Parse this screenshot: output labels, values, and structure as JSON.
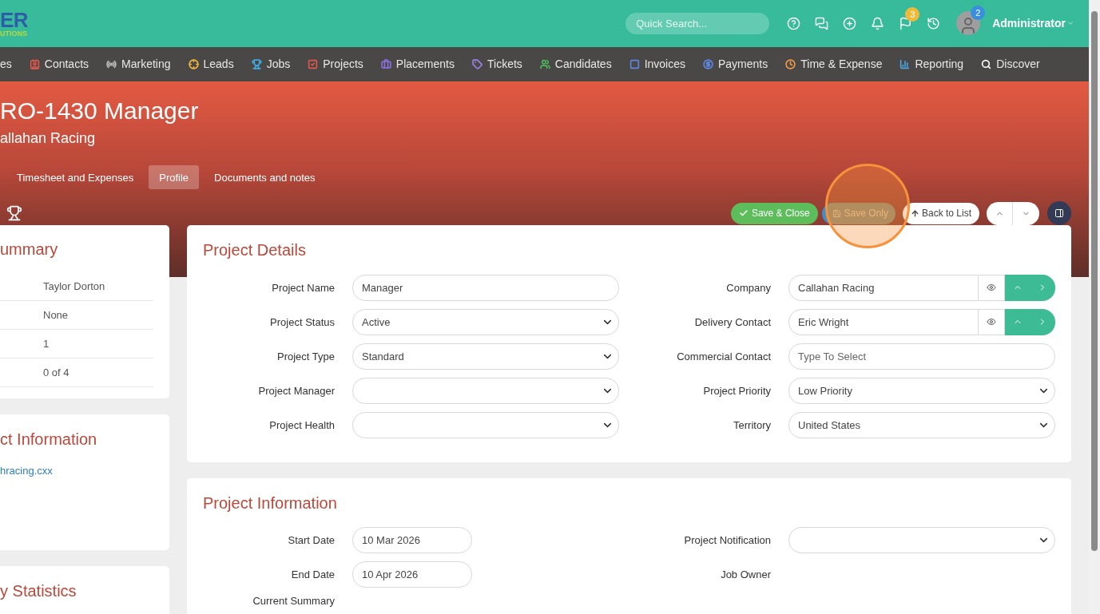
{
  "header": {
    "logo_main": "ER",
    "logo_sub": "UTIONS",
    "search": {
      "placeholder": "Quick Search..."
    },
    "flag_badge": "3",
    "avatar_badge": "2",
    "user": "Administrator"
  },
  "nav": [
    {
      "label": "es"
    },
    {
      "label": "Contacts",
      "color": "#e2574c"
    },
    {
      "label": "Marketing",
      "color": "#bdbdbd"
    },
    {
      "label": "Leads",
      "color": "#f2b63c"
    },
    {
      "label": "Jobs",
      "color": "#3fa9de"
    },
    {
      "label": "Projects",
      "color": "#e2574c"
    },
    {
      "label": "Placements",
      "color": "#8c6ee0"
    },
    {
      "label": "Tickets",
      "color": "#a083e8"
    },
    {
      "label": "Candidates",
      "color": "#4cb85c"
    },
    {
      "label": "Invoices",
      "color": "#5f86e0"
    },
    {
      "label": "Payments",
      "color": "#5f86e0"
    },
    {
      "label": "Time & Expense",
      "color": "#f09a48"
    },
    {
      "label": "Reporting",
      "color": "#4aa6e0"
    },
    {
      "label": "Discover",
      "color": "#ffffff"
    }
  ],
  "hero": {
    "title": "RO-1430 Manager",
    "subtitle": "allahan Racing",
    "tabs": [
      {
        "label": "Timesheet and Expenses",
        "selected": false
      },
      {
        "label": "Profile",
        "selected": true
      },
      {
        "label": "Documents and notes",
        "selected": false
      }
    ],
    "buttons": [
      {
        "kind": "save_close",
        "label": "Save & Close"
      },
      {
        "kind": "save_only",
        "label": "Save Only"
      },
      {
        "kind": "back",
        "label": "Back to List"
      }
    ]
  },
  "summary": {
    "title": "ummary",
    "rows": [
      "Taylor Dorton",
      "None",
      "1",
      "0 of 4"
    ]
  },
  "contact_info": {
    "title": "ct Information",
    "link": "hracing.cxx"
  },
  "statistics": {
    "title": "y Statistics"
  },
  "project_details": {
    "title": "Project Details",
    "fields": [
      {
        "label": "Project Name",
        "kind": "text",
        "value": "Manager"
      },
      {
        "label": "Company",
        "kind": "lookup",
        "value": "Callahan Racing"
      },
      {
        "label": "Project Status",
        "kind": "select",
        "value": "Active"
      },
      {
        "label": "Delivery Contact",
        "kind": "lookup",
        "value": "Eric Wright"
      },
      {
        "label": "Project Type",
        "kind": "select",
        "value": "Standard"
      },
      {
        "label": "Commercial Contact",
        "kind": "text",
        "placeholder": "Type To Select"
      },
      {
        "label": "Project Manager",
        "kind": "select"
      },
      {
        "label": "Project Priority",
        "kind": "select",
        "value": "Low Priority"
      },
      {
        "label": "Project Health",
        "kind": "select"
      },
      {
        "label": "Territory",
        "kind": "select",
        "value": "United States"
      }
    ]
  },
  "project_information": {
    "title": "Project Information",
    "fields": [
      {
        "label": "Start Date",
        "kind": "date",
        "value": "10 Mar 2026"
      },
      {
        "label": "Project Notification",
        "kind": "select"
      },
      {
        "label": "End Date",
        "kind": "date",
        "value": "10 Apr 2026"
      },
      {
        "label": "Job Owner",
        "kind": "static"
      }
    ],
    "summary_label": "Current Summary"
  }
}
